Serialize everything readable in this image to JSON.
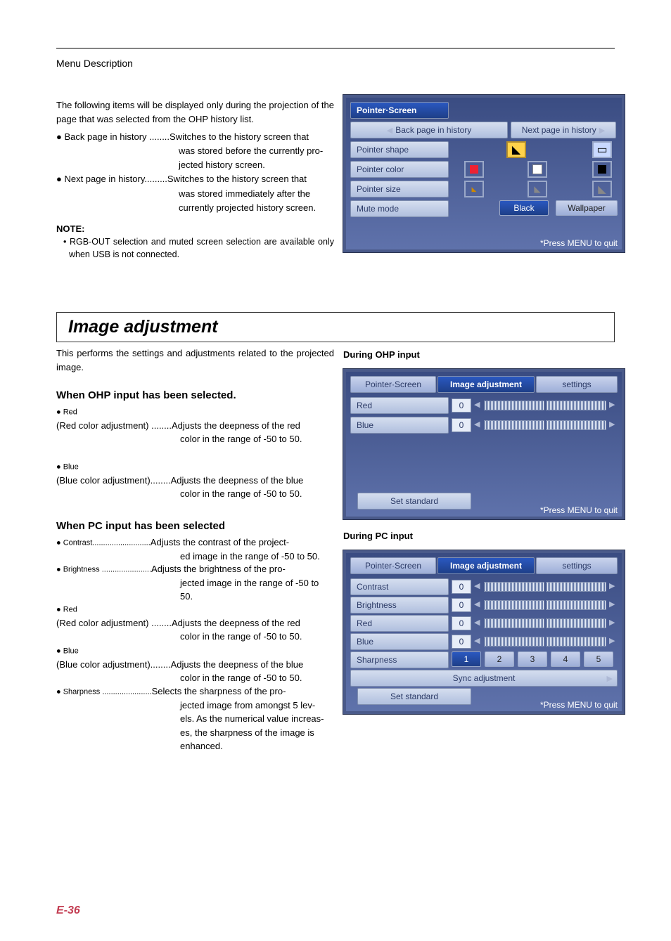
{
  "header": {
    "chapter": "Menu Description"
  },
  "intro": "The following items will be displayed only during the projection of the page that was selected from the OHP history list.",
  "historyList": [
    {
      "bullet": "● Back page in history ........",
      "first": "Switches to the history screen that",
      "cont": [
        "was stored before the currently pro-",
        "jected history screen."
      ]
    },
    {
      "bullet": "● Next page in history.........",
      "first": "Switches to the history screen that",
      "cont": [
        "was stored immediately after the",
        "currently projected history screen."
      ]
    }
  ],
  "note": {
    "title": "NOTE:",
    "body": "•  RGB-OUT selection and muted screen selection are available only when USB is not connected."
  },
  "sectionTitle": "Image adjustment",
  "sectionIntro": "This performs the settings and adjustments related to the projected image.",
  "h3a": "When OHP input has been selected.",
  "h3b": "When PC input has been selected",
  "red": {
    "bullet": "● Red",
    "label": "(Red color adjustment) ........",
    "first": "Adjusts the deepness of the red",
    "cont": [
      "color in the range of -50 to 50."
    ]
  },
  "blue": {
    "bullet": "● Blue",
    "label": "(Blue color adjustment)........",
    "first": "Adjusts the deepness of the blue",
    "cont": [
      "color in the range of -50 to 50."
    ]
  },
  "contrast": {
    "bullet": "● Contrast...........................",
    "first": "Adjusts the contrast of the project-",
    "cont": [
      "ed image in the range of -50 to 50."
    ]
  },
  "bright": {
    "bullet": "● Brightness .......................",
    "first": "Adjusts the brightness of the pro-",
    "cont": [
      "jected image in the range of -50 to",
      "50."
    ]
  },
  "sharp": {
    "bullet": "● Sharpness .......................",
    "first": "Selects the sharpness of the pro-",
    "cont": [
      "jected image from amongst 5 lev-",
      "els. As the numerical value increas-",
      "es, the sharpness of the image is",
      "enhanced."
    ]
  },
  "pageno": "E-36",
  "captions": {
    "ohp": "During OHP input",
    "pc": "During PC input"
  },
  "ui": {
    "pressMenu": "*Press MENU to quit",
    "tabs": {
      "pointer": "Pointer·Screen",
      "image": "Image adjustment",
      "settings": "settings"
    },
    "backHist": "Back page in history",
    "nextHist": "Next page in history",
    "pshape": "Pointer shape",
    "pcolor": "Pointer color",
    "psize": "Pointer size",
    "mute": "Mute mode",
    "black": "Black",
    "wallpaper": "Wallpaper",
    "red": "Red",
    "blue": "Blue",
    "contrastL": "Contrast",
    "brightL": "Brightness",
    "sharpL": "Sharpness",
    "sync": "Sync adjustment",
    "setstd": "Set standard",
    "zero": "0",
    "sharpNums": [
      "1",
      "2",
      "3",
      "4",
      "5"
    ]
  }
}
